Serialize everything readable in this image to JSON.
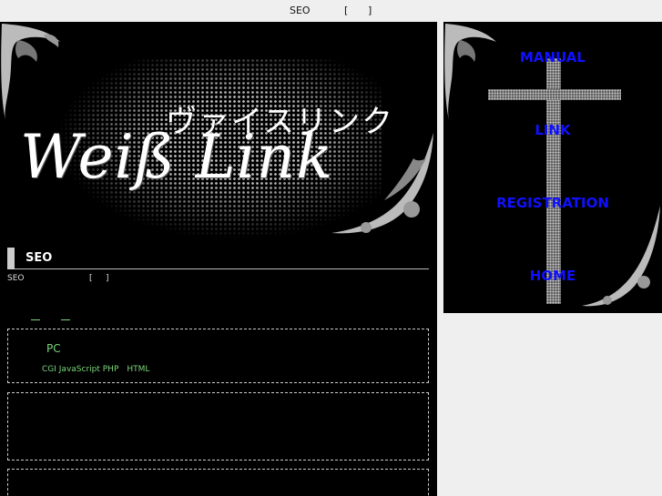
{
  "topbar": {
    "t1": "SEO",
    "t2": "[",
    "t3": "]"
  },
  "banner": {
    "jp_title": "ヴァイスリンク",
    "logo_text": "Weiß Link"
  },
  "section": {
    "title": "SEO",
    "desc1": "SEO",
    "desc2": "[",
    "desc3": "]",
    "link1": "　",
    "link2": "　"
  },
  "boxes": [
    {
      "title": "PC",
      "sub": "CGI JavaScript PHP　HTML"
    }
  ],
  "nav": {
    "items": [
      {
        "label": "MANUAL"
      },
      {
        "label": "LINK"
      },
      {
        "label": "REGISTRATION"
      },
      {
        "label": "HOME"
      }
    ]
  },
  "colors": {
    "accent_green": "#7bd67b",
    "nav_blue": "#1010ff"
  }
}
